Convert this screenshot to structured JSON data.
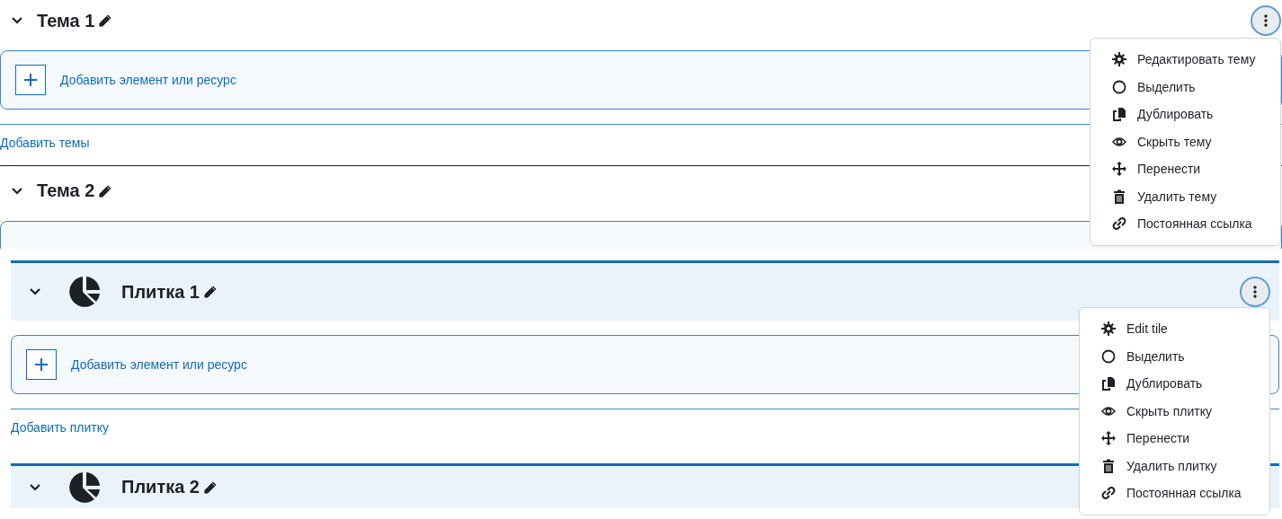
{
  "panels": [
    {
      "kind": "topic",
      "sections": [
        {
          "title": "Тема 1",
          "expanded": true,
          "add_button": "Добавить элемент или ресурс"
        },
        {
          "title": "Тема 2",
          "expanded": true
        }
      ],
      "add_link": "Добавить темы",
      "menu": [
        {
          "kind": "gear",
          "label": "Редактировать тему"
        },
        {
          "kind": "circle",
          "label": "Выделить"
        },
        {
          "kind": "copy",
          "label": "Дублировать"
        },
        {
          "kind": "eye",
          "label": "Скрыть тему"
        },
        {
          "kind": "move",
          "label": "Перенести"
        },
        {
          "kind": "trash",
          "label": "Удалить тему"
        },
        {
          "kind": "link",
          "label": "Постоянная ссылка"
        }
      ]
    },
    {
      "kind": "tile",
      "sections": [
        {
          "title": "Плитка 1",
          "expanded": true,
          "add_button": "Добавить элемент или ресурс"
        },
        {
          "title": "Плитка 2",
          "expanded": true
        }
      ],
      "add_link": "Добавить плитку",
      "menu": [
        {
          "kind": "gear",
          "label": "Edit tile"
        },
        {
          "kind": "circle",
          "label": "Выделить"
        },
        {
          "kind": "copy",
          "label": "Дублировать"
        },
        {
          "kind": "eye",
          "label": "Скрыть плитку"
        },
        {
          "kind": "move",
          "label": "Перенести"
        },
        {
          "kind": "trash",
          "label": "Удалить плитку"
        },
        {
          "kind": "link",
          "label": "Постоянная ссылка"
        }
      ]
    }
  ]
}
